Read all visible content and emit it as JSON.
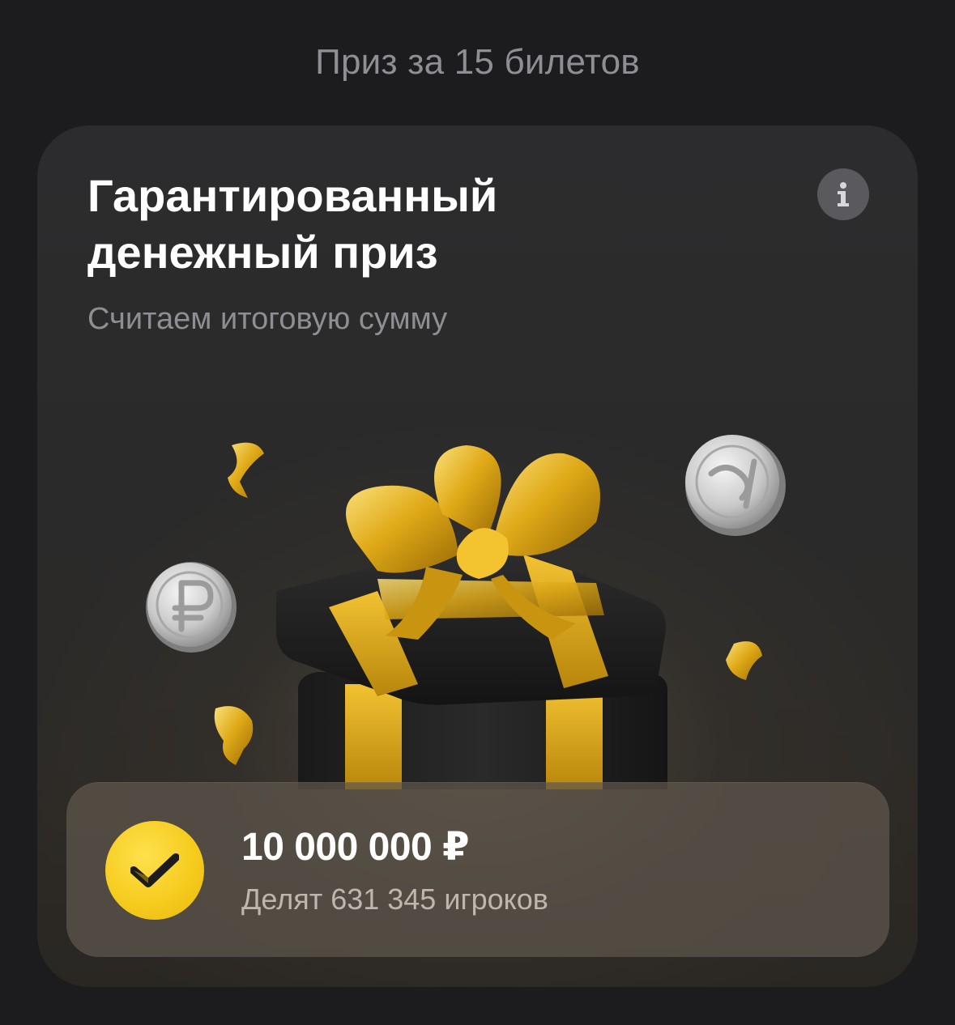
{
  "section": {
    "title": "Приз за 15 билетов"
  },
  "card": {
    "title": "Гарантированный денежный приз",
    "subtitle": "Считаем итоговую сумму",
    "info_icon": "info-icon",
    "illustration": {
      "icons": [
        "gift-box-icon",
        "ruble-coin-icon",
        "confetti-icon"
      ]
    },
    "prize": {
      "amount": "10 000 000 ₽",
      "shared_by": "Делят 631 345 игроков",
      "badge_icon": "check-icon"
    }
  },
  "colors": {
    "accent_yellow": "#f6cc1f",
    "ribbon_gold": "#d9a514",
    "background": "#1c1c1e",
    "card": "#2c2c2e"
  }
}
